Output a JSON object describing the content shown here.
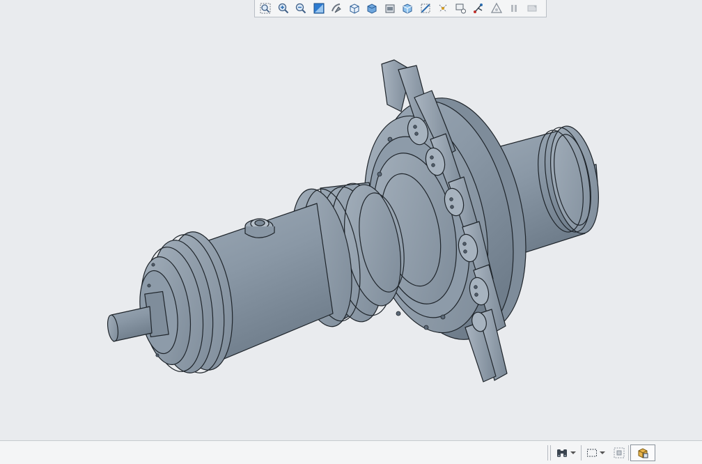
{
  "app": {
    "view_toolbar": {
      "buttons": [
        {
          "name": "refit-icon"
        },
        {
          "name": "zoom-in-icon"
        },
        {
          "name": "zoom-out-icon"
        },
        {
          "name": "repaint-icon"
        },
        {
          "name": "reorient-icon"
        },
        {
          "name": "saved-orientations-icon"
        },
        {
          "name": "display-style-icon"
        },
        {
          "name": "view-manager-icon"
        },
        {
          "name": "perspective-view-icon"
        },
        {
          "name": "section-icon"
        },
        {
          "name": "datum-display-icon"
        },
        {
          "name": "annotation-display-icon"
        },
        {
          "name": "spin-center-icon"
        },
        {
          "name": "regenerate-icon"
        },
        {
          "name": "pause-icon"
        },
        {
          "name": "stop-icon"
        }
      ]
    },
    "status_bar": {
      "find_icon": "binoculars-icon",
      "selection_filter_icon": "box-select-icon",
      "smart_filter_icon": "filter-icon",
      "model_view_icon": "model-view-icon"
    },
    "colors": {
      "background": "#e9ebee",
      "model_body": "#8e9caa",
      "model_highlight": "#b4c0cc",
      "model_shadow": "#6c7a88",
      "edges": "#1e242a"
    }
  }
}
